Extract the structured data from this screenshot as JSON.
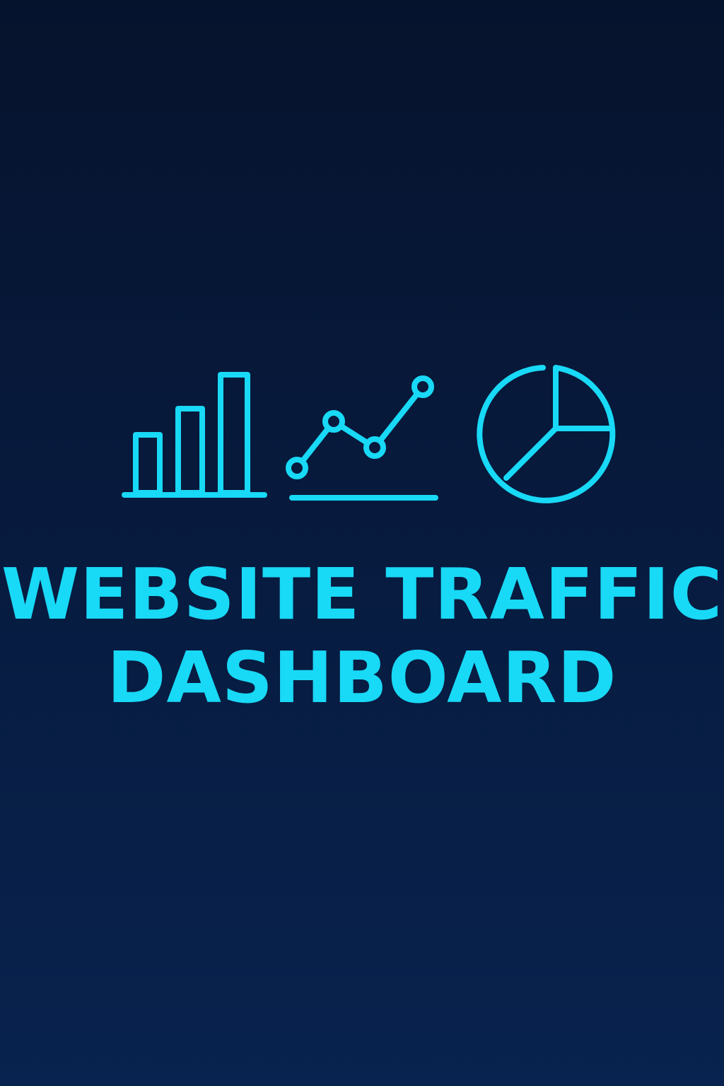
{
  "title": {
    "line1": "WEBSITE TRAFFIC",
    "line2": "DASHBOARD"
  },
  "icons": [
    "bar-chart-icon",
    "line-chart-icon",
    "pie-chart-icon"
  ],
  "colors": {
    "accent": "#18d9f6",
    "background_top": "#06132d",
    "background_bottom": "#08234f"
  }
}
